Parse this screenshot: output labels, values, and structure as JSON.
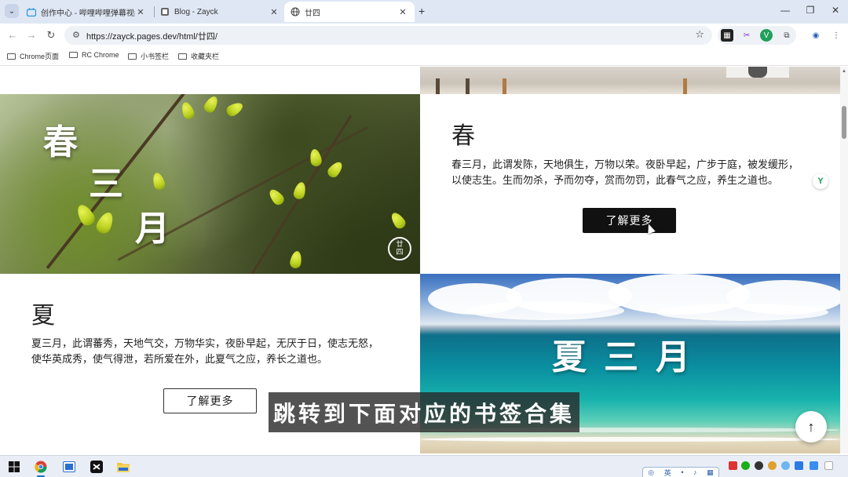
{
  "browser": {
    "tabs": [
      {
        "label": "创作中心 - 哔哩哔哩弹幕视频网",
        "icon": "bilibili-icon"
      },
      {
        "label": "Blog - Zayck",
        "icon": "blog-icon"
      },
      {
        "label": "廿四",
        "icon": "globe-icon",
        "active": true
      }
    ],
    "url": "https://zayck.pages.dev/html/廿四/",
    "bookmarks": [
      "Chrome页面",
      "RC Chrome",
      "小书签栏",
      "收藏夹栏"
    ]
  },
  "page": {
    "spring": {
      "image_chars": [
        "春",
        "三",
        "月"
      ],
      "seal": [
        "廿",
        "四"
      ],
      "heading": "春",
      "text_line1": "春三月，此谓发陈，天地俱生，万物以荣。夜卧早起，广步于庭，被发缓形，",
      "text_line2": "以使志生。生而勿杀，予而勿夺，赏而勿罚，此春气之应，养生之道也。",
      "button": "了解更多"
    },
    "summer": {
      "heading": "夏",
      "text_line1": "夏三月，此谓蕃秀，天地气交，万物华实，夜卧早起，无厌于日，使志无怒，",
      "text_line2": "使华英成秀，使气得泄，若所爱在外，此夏气之应，养长之道也。",
      "button": "了解更多",
      "image_title": "夏三月"
    },
    "back_to_top": "↑"
  },
  "overlay": {
    "subtitle": "跳转到下面对应的书签合集"
  },
  "taskbar": {
    "ime_label": "英"
  },
  "colors": {
    "button_dark": "#111111",
    "tabstrip": "#dfe7f5"
  }
}
